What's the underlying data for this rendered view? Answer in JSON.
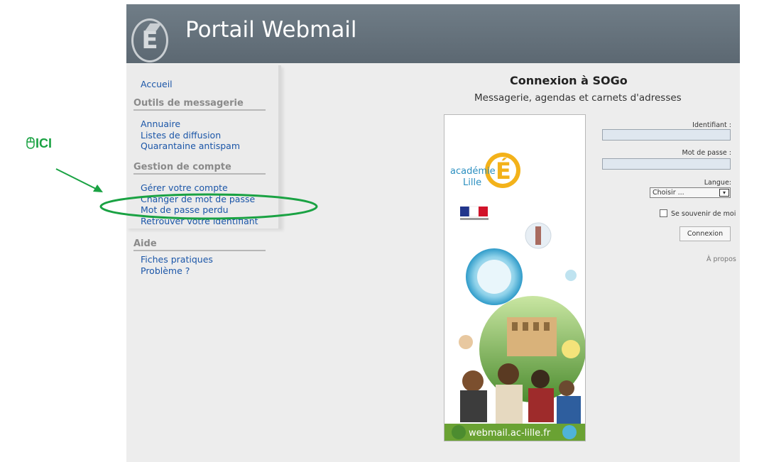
{
  "header": {
    "title": "Portail Webmail",
    "logo_letter": "É"
  },
  "sidebar": {
    "home": "Accueil",
    "sections": [
      {
        "title": "Outils de messagerie",
        "items": [
          "Annuaire",
          "Listes de diffusion",
          "Quarantaine antispam"
        ]
      },
      {
        "title": "Gestion de compte",
        "items": [
          "Gérer votre compte",
          "Changer de mot de passe",
          "Mot de passe perdu",
          "Retrouver votre identifiant"
        ]
      },
      {
        "title": "Aide",
        "items": [
          "Fiches pratiques",
          "Problème ?"
        ]
      }
    ]
  },
  "main": {
    "title": "Connexion à SOGo",
    "subtitle": "Messagerie, agendas et carnets d'adresses",
    "banner": {
      "academie": "académie",
      "lille": "Lille",
      "logo_letter": "É",
      "url": "webmail.ac-lille.fr"
    }
  },
  "login": {
    "id_label": "Identifiant :",
    "password_label": "Mot de passe :",
    "language_label": "Langue:",
    "language_value": "Choisir ...",
    "remember_label": "Se souvenir de moi",
    "button": "Connexion",
    "about": "À propos"
  },
  "annotation": {
    "text": "ICI",
    "icon": "mouse-icon",
    "color": "#1aa243"
  },
  "colors": {
    "link": "#1b56a8",
    "header": "#66727c",
    "background": "#ededed",
    "annotation": "#1aa243"
  }
}
